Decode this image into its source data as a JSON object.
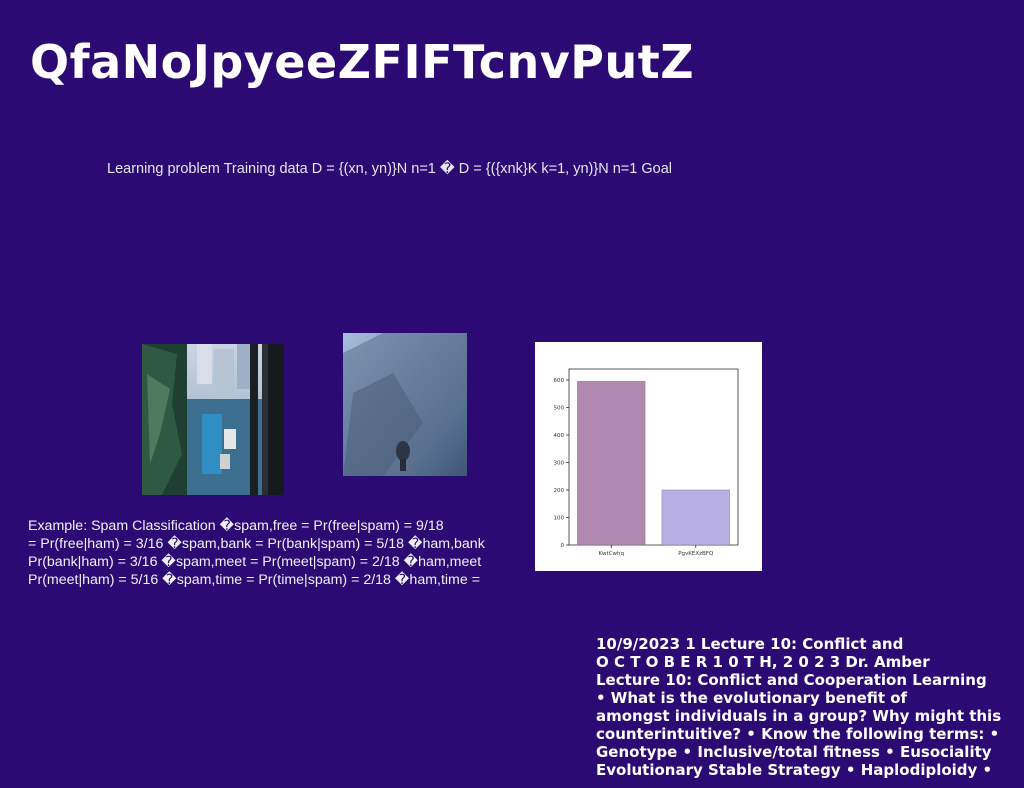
{
  "slide": {
    "title": "QfaNoJpyeeZFIFTcnvPutZ",
    "subtitle": "Learning problem Training data D = {(xn, yn)}N n=1 � D = {({xnk}K k=1, yn)}N n=1 Goal",
    "example_lines": [
      "Example: Spam Classification �spam,free = Pr(free|spam) = 9/18",
      "= Pr(free|ham) = 3/16 �spam,bank = Pr(bank|spam) = 5/18 �ham,bank",
      "Pr(bank|ham) = 3/16 �spam,meet = Pr(meet|spam) = 2/18 �ham,meet",
      "Pr(meet|ham) = 5/16 �spam,time = Pr(time|spam) = 2/18 �ham,time ="
    ],
    "lecture_lines": [
      "10/9/2023 1 Lecture 10: Conflict and",
      "O C T O B E R 1 0 T H, 2 0 2 3 Dr. Amber",
      "Lecture 10: Conflict and Cooperation Learning",
      "• What is the evolutionary benefit of",
      "amongst individuals in a group? Why might this",
      "counterintuitive? • Know the following terms: •",
      "Genotype • Inclusive/total fitness • Eusociality",
      "Evolutionary Stable Strategy • Haplodiploidy •"
    ],
    "background_color": "#2b0b73"
  },
  "chart_data": {
    "type": "bar",
    "categories": [
      "KwtCwhq",
      "PgvKEXzBFQ"
    ],
    "values": [
      595,
      200
    ],
    "colors": [
      "#b088b0",
      "#b8b0e4"
    ],
    "title": "",
    "xlabel": "",
    "ylabel": "",
    "ylim": [
      0,
      640
    ],
    "yticks": [
      0,
      100,
      200,
      300,
      400,
      500,
      600
    ],
    "grid": false
  }
}
